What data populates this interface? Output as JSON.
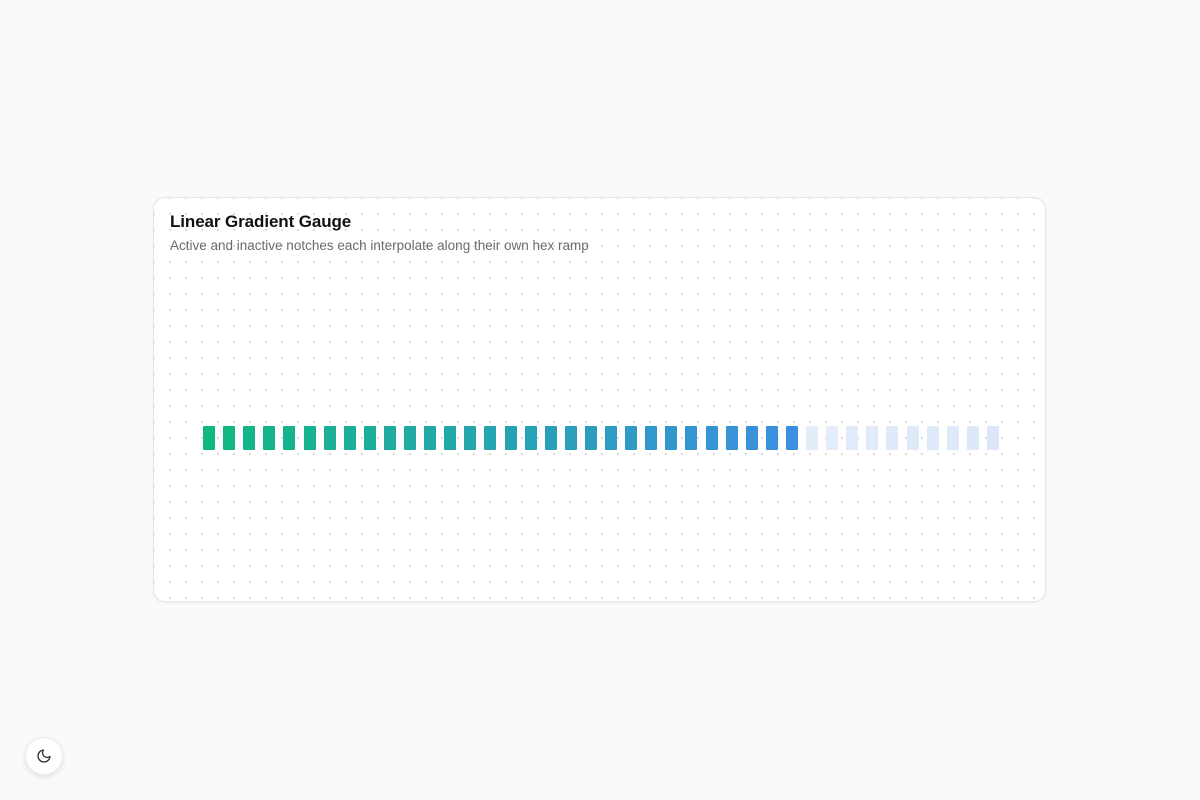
{
  "card": {
    "title": "Linear Gradient Gauge",
    "subtitle": "Active and inactive notches each interpolate along their own hex ramp"
  },
  "gauge": {
    "total_notches": 40,
    "active_notches": 30,
    "active_ramp": [
      "#10b981",
      "#3b8fe0"
    ],
    "inactive_ramp": [
      "#e3edfa",
      "#dce8f9"
    ]
  },
  "theme_toggle": {
    "icon": "moon-icon"
  }
}
